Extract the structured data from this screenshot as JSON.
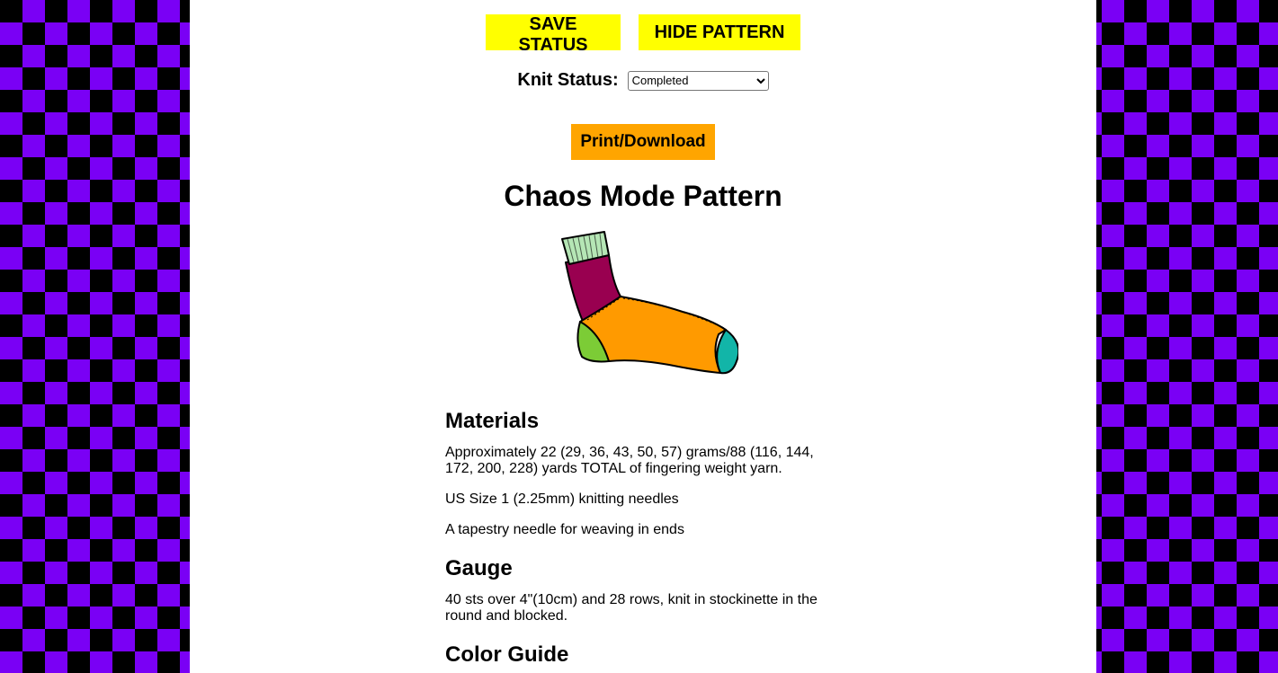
{
  "toolbar": {
    "save_label": "SAVE STATUS",
    "hide_label": "HIDE PATTERN"
  },
  "knit_status": {
    "label": "Knit Status:",
    "selected": "Completed"
  },
  "print_label": "Print/Download",
  "pattern": {
    "title": "Chaos Mode Pattern",
    "sock_colors": {
      "cuff": "#b5e6b5",
      "leg": "#990050",
      "foot": "#ff9a00",
      "heel": "#7ccc36",
      "toe": "#12b5a8"
    },
    "sections": {
      "materials": {
        "heading": "Materials",
        "items": [
          "Approximately 22 (29, 36, 43, 50, 57) grams/88 (116, 144, 172, 200, 228) yards TOTAL of fingering weight yarn.",
          "US Size 1 (2.25mm) knitting needles",
          "A tapestry needle for weaving in ends"
        ]
      },
      "gauge": {
        "heading": "Gauge",
        "text": "40 sts over 4\"(10cm) and 28 rows, knit in stockinette in the round and blocked."
      },
      "color_guide": {
        "heading": "Color Guide"
      }
    }
  },
  "background_colors": {
    "purple": "#7a00f5",
    "black": "#000000"
  }
}
